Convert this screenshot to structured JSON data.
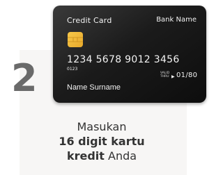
{
  "step": {
    "number": "2"
  },
  "card": {
    "title": "Credit Card",
    "bank_name": "Bank Name",
    "number": "1234  5678  9012  3456",
    "small_number": "0123",
    "valid_thru_line1": "VALID",
    "valid_thru_line2": "THRU",
    "expiry": "01/80",
    "holder": "Name Surname"
  },
  "instruction": {
    "line1": "Masukan",
    "bold_line2": "16 digit kartu",
    "bold_line3": "kredit",
    "tail": " Anda"
  },
  "colors": {
    "panel": "#f7f6f5",
    "step_number": "#6a6a6a",
    "card_dark": "#1b1b1b",
    "chip": "#f0b83a",
    "text": "#333333"
  }
}
